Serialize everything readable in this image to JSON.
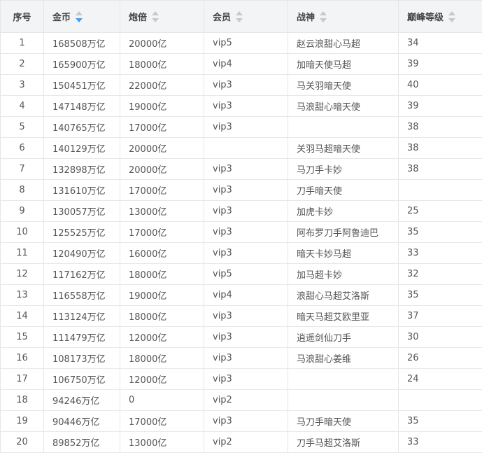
{
  "columns": {
    "index": "序号",
    "gold": "金币",
    "cannon": "炮倍",
    "member": "会员",
    "god": "战神",
    "peak": "巅峰等级"
  },
  "sort": {
    "column": "gold",
    "direction": "desc"
  },
  "rows": [
    {
      "index": "1",
      "gold": "168508万亿",
      "cannon": "20000亿",
      "member": "vip5",
      "god": "赵云浪甜心马超",
      "peak": "34"
    },
    {
      "index": "2",
      "gold": "165900万亿",
      "cannon": "18000亿",
      "member": "vip4",
      "god": "加暗天使马超",
      "peak": "39"
    },
    {
      "index": "3",
      "gold": "150451万亿",
      "cannon": "22000亿",
      "member": "vip3",
      "god": "马关羽暗天使",
      "peak": "40"
    },
    {
      "index": "4",
      "gold": "147148万亿",
      "cannon": "19000亿",
      "member": "vip3",
      "god": "马浪甜心暗天使",
      "peak": "39"
    },
    {
      "index": "5",
      "gold": "140765万亿",
      "cannon": "17000亿",
      "member": "vip3",
      "god": "",
      "peak": "38"
    },
    {
      "index": "6",
      "gold": "140129万亿",
      "cannon": "20000亿",
      "member": "",
      "god": "关羽马超暗天使",
      "peak": "38"
    },
    {
      "index": "7",
      "gold": "132898万亿",
      "cannon": "20000亿",
      "member": "vip3",
      "god": "马刀手卡妙",
      "peak": "38"
    },
    {
      "index": "8",
      "gold": "131610万亿",
      "cannon": "17000亿",
      "member": "vip3",
      "god": "刀手暗天使",
      "peak": ""
    },
    {
      "index": "9",
      "gold": "130057万亿",
      "cannon": "13000亿",
      "member": "vip3",
      "god": "加虎卡妙",
      "peak": "25"
    },
    {
      "index": "10",
      "gold": "125525万亿",
      "cannon": "17000亿",
      "member": "vip3",
      "god": "阿布罗刀手阿鲁迪巴",
      "peak": "35"
    },
    {
      "index": "11",
      "gold": "120490万亿",
      "cannon": "16000亿",
      "member": "vip3",
      "god": "暗天卡妙马超",
      "peak": "33"
    },
    {
      "index": "12",
      "gold": "117162万亿",
      "cannon": "18000亿",
      "member": "vip5",
      "god": "加马超卡妙",
      "peak": "32"
    },
    {
      "index": "13",
      "gold": "116558万亿",
      "cannon": "19000亿",
      "member": "vip4",
      "god": "浪甜心马超艾洛斯",
      "peak": "35"
    },
    {
      "index": "14",
      "gold": "113124万亿",
      "cannon": "18000亿",
      "member": "vip3",
      "god": "暗天马超艾欧里亚",
      "peak": "37"
    },
    {
      "index": "15",
      "gold": "111479万亿",
      "cannon": "12000亿",
      "member": "vip3",
      "god": "逍遥剑仙刀手",
      "peak": "30"
    },
    {
      "index": "16",
      "gold": "108173万亿",
      "cannon": "18000亿",
      "member": "vip3",
      "god": "马浪甜心姜维",
      "peak": "26"
    },
    {
      "index": "17",
      "gold": "106750万亿",
      "cannon": "12000亿",
      "member": "vip3",
      "god": "",
      "peak": "24"
    },
    {
      "index": "18",
      "gold": "94246万亿",
      "cannon": "0",
      "member": "vip2",
      "god": "",
      "peak": ""
    },
    {
      "index": "19",
      "gold": "90446万亿",
      "cannon": "17000亿",
      "member": "vip3",
      "god": "马刀手暗天使",
      "peak": "35"
    },
    {
      "index": "20",
      "gold": "89852万亿",
      "cannon": "13000亿",
      "member": "vip2",
      "god": "刀手马超艾洛斯",
      "peak": "33"
    }
  ],
  "colors": {
    "header_bg": "#f3f4f6",
    "border": "#e6e6e6",
    "sort_active": "#409eff",
    "sort_idle": "#c6c9cf"
  }
}
